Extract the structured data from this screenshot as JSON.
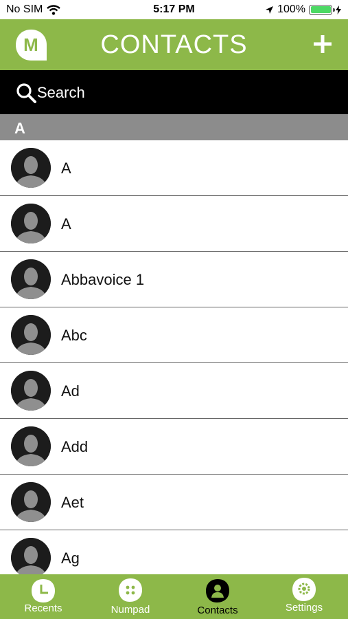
{
  "status_bar": {
    "carrier": "No SIM",
    "time": "5:17 PM",
    "battery": "100%",
    "battery_level": 1.0
  },
  "nav": {
    "logo_letter": "M",
    "title": "CONTACTS",
    "add_label": "+"
  },
  "search": {
    "label": "Search"
  },
  "section": {
    "letter": "A"
  },
  "contacts": [
    {
      "name": "A"
    },
    {
      "name": "A"
    },
    {
      "name": "Abbavoice 1"
    },
    {
      "name": "Abc"
    },
    {
      "name": "Ad"
    },
    {
      "name": "Add"
    },
    {
      "name": "Aet"
    },
    {
      "name": "Ag"
    }
  ],
  "tabs": [
    {
      "label": "Recents",
      "icon": "clock-icon",
      "active": false
    },
    {
      "label": "Numpad",
      "icon": "numpad-icon",
      "active": false
    },
    {
      "label": "Contacts",
      "icon": "contacts-icon",
      "active": true
    },
    {
      "label": "Settings",
      "icon": "gear-icon",
      "active": false
    }
  ],
  "colors": {
    "brand_green": "#8db849",
    "search_bg": "#000000",
    "section_bg": "#8c8c8c",
    "active_tab_text": "#000000",
    "inactive_tab_text": "#ffffff"
  }
}
